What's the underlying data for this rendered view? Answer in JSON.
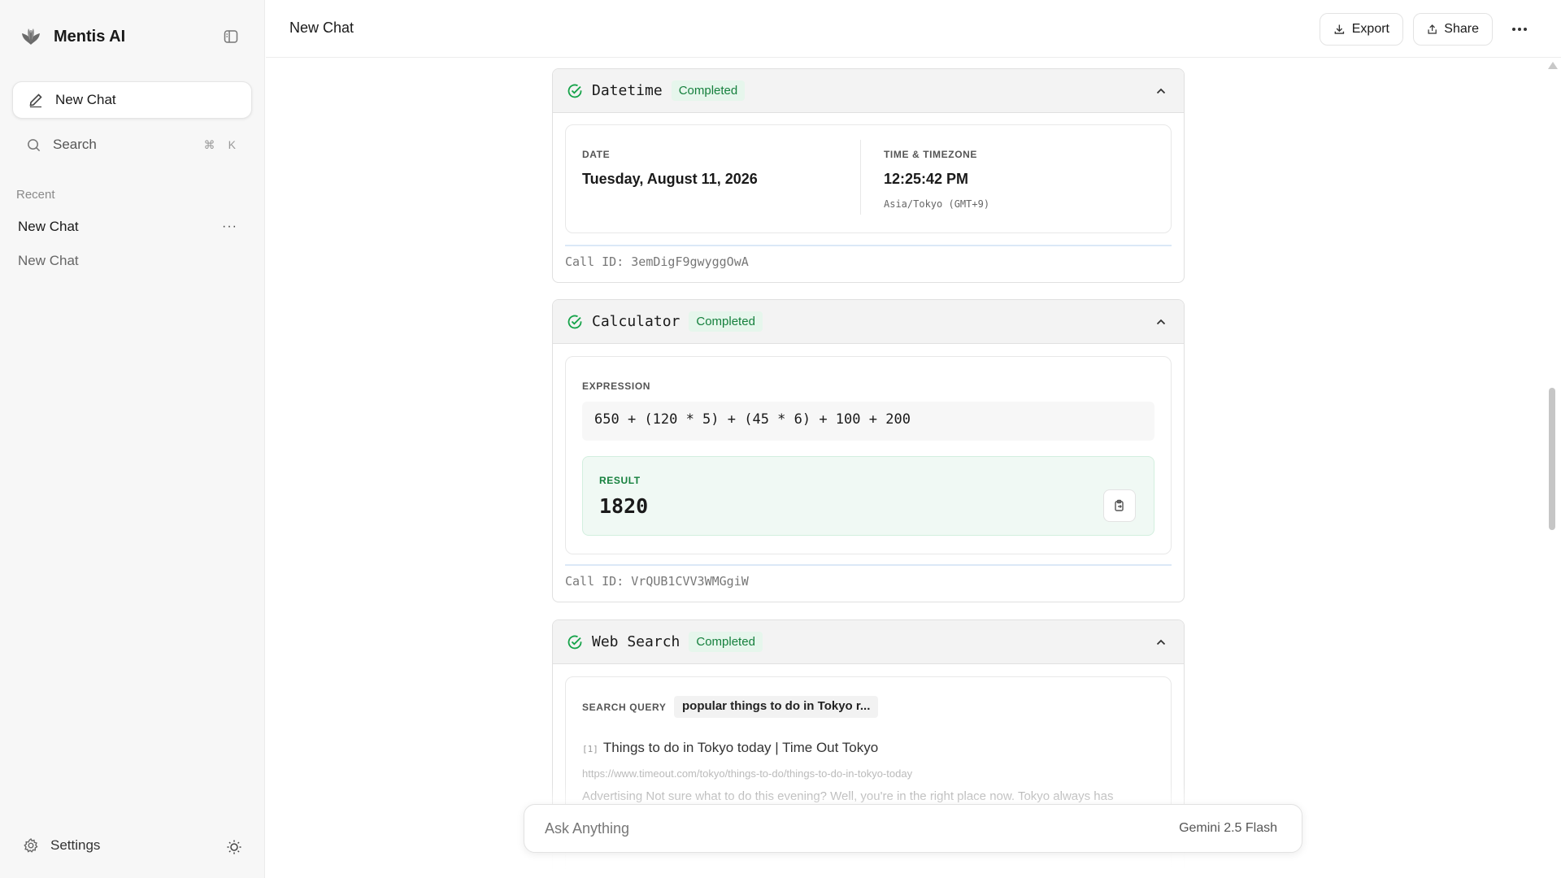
{
  "sidebar": {
    "brand_name": "Mentis AI",
    "new_chat_label": "New Chat",
    "search_label": "Search",
    "search_shortcut": [
      "⌘",
      "K"
    ],
    "recent_label": "Recent",
    "recent_items": [
      {
        "label": "New Chat",
        "active": true,
        "more": "···"
      },
      {
        "label": "New Chat",
        "active": false
      }
    ],
    "settings_label": "Settings"
  },
  "header": {
    "title": "New Chat",
    "export_label": "Export",
    "share_label": "Share"
  },
  "tools": {
    "status_label": "Completed",
    "datetime": {
      "name": "Datetime",
      "date_label": "DATE",
      "date_value": "Tuesday, August 11, 2026",
      "time_label": "TIME & TIMEZONE",
      "time_value": "12:25:42 PM",
      "timezone": "Asia/Tokyo (GMT+9)",
      "call_id": "Call ID: 3emDigF9gwyggOwA"
    },
    "calculator": {
      "name": "Calculator",
      "expression_label": "EXPRESSION",
      "expression": "650 + (120 * 5) + (45 * 6) + 100 + 200",
      "result_label": "RESULT",
      "result": "1820",
      "call_id": "Call ID: VrQUB1CVV3WMGgiW"
    },
    "web_search": {
      "name": "Web Search",
      "query_label": "SEARCH QUERY",
      "query": "popular things to do in Tokyo r...",
      "results": [
        {
          "index": "[1]",
          "title": "Things to do in Tokyo today | Time Out Tokyo",
          "url": "https://www.timeout.com/tokyo/things-to-do/things-to-do-in-tokyo-today",
          "snippet": "Advertising Not sure what to do this evening? Well, you're in the right place now. Tokyo always has"
        }
      ]
    }
  },
  "chat_input": {
    "placeholder": "Ask Anything",
    "model": "Gemini 2.5 Flash"
  },
  "colors": {
    "success_green": "#15803d",
    "success_bg": "#e6f6ec",
    "sidebar_bg": "#f7f7f7"
  }
}
